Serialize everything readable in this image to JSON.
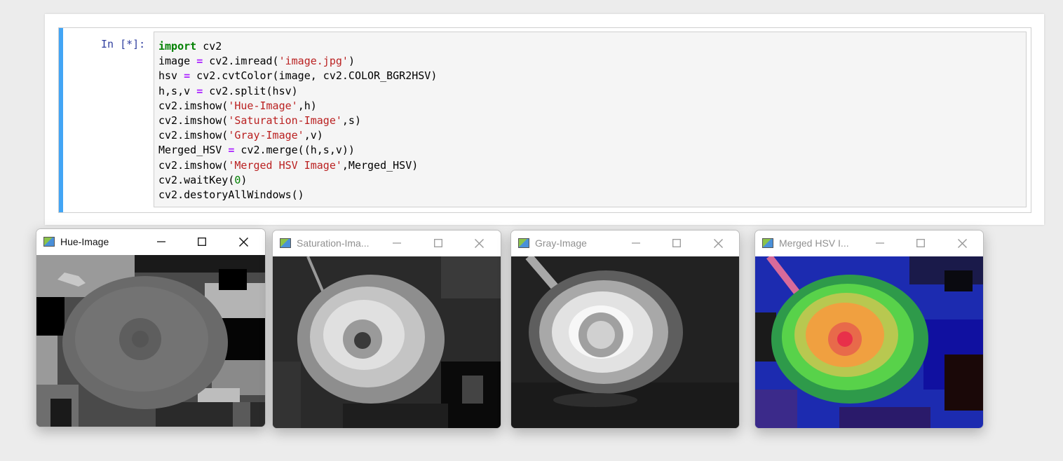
{
  "notebook": {
    "prompt": "In [*]:",
    "code_lines": [
      [
        {
          "t": "import",
          "c": "kw"
        },
        {
          "t": " cv2"
        }
      ],
      [
        {
          "t": "image "
        },
        {
          "t": "=",
          "c": "op"
        },
        {
          "t": " cv2.imread("
        },
        {
          "t": "'image.jpg'",
          "c": "str"
        },
        {
          "t": ")"
        }
      ],
      [
        {
          "t": "hsv "
        },
        {
          "t": "=",
          "c": "op"
        },
        {
          "t": " cv2.cvtColor(image, cv2.COLOR_BGR2HSV)"
        }
      ],
      [
        {
          "t": "h,s,v "
        },
        {
          "t": "=",
          "c": "op"
        },
        {
          "t": " cv2.split(hsv)"
        }
      ],
      [
        {
          "t": "cv2.imshow("
        },
        {
          "t": "'Hue-Image'",
          "c": "str"
        },
        {
          "t": ",h)"
        }
      ],
      [
        {
          "t": "cv2.imshow("
        },
        {
          "t": "'Saturation-Image'",
          "c": "str"
        },
        {
          "t": ",s)"
        }
      ],
      [
        {
          "t": "cv2.imshow("
        },
        {
          "t": "'Gray-Image'",
          "c": "str"
        },
        {
          "t": ",v)"
        }
      ],
      [
        {
          "t": "Merged_HSV "
        },
        {
          "t": "=",
          "c": "op"
        },
        {
          "t": " cv2.merge((h,s,v))"
        }
      ],
      [
        {
          "t": "cv2.imshow("
        },
        {
          "t": "'Merged HSV Image'",
          "c": "str"
        },
        {
          "t": ",Merged_HSV)"
        }
      ],
      [
        {
          "t": "cv2.waitKey("
        },
        {
          "t": "0",
          "c": "num"
        },
        {
          "t": ")"
        }
      ],
      [
        {
          "t": "cv2.destoryAllWindows()"
        }
      ]
    ]
  },
  "windows": [
    {
      "title": "Hue-Image",
      "active": true,
      "image": "hue"
    },
    {
      "title": "Saturation-Ima...",
      "active": false,
      "image": "saturation"
    },
    {
      "title": "Gray-Image",
      "active": false,
      "image": "gray"
    },
    {
      "title": "Merged HSV I...",
      "active": false,
      "image": "merged"
    }
  ],
  "icons": {
    "window_icon": "opencv-window-icon",
    "minimize": "minimize-icon",
    "maximize": "maximize-icon",
    "close": "close-icon"
  },
  "colors": {
    "cell_accent": "#42a5f5",
    "prompt": "#303f9f",
    "keyword": "#008000",
    "operator": "#aa22ff",
    "string": "#ba2121",
    "number": "#008000"
  }
}
